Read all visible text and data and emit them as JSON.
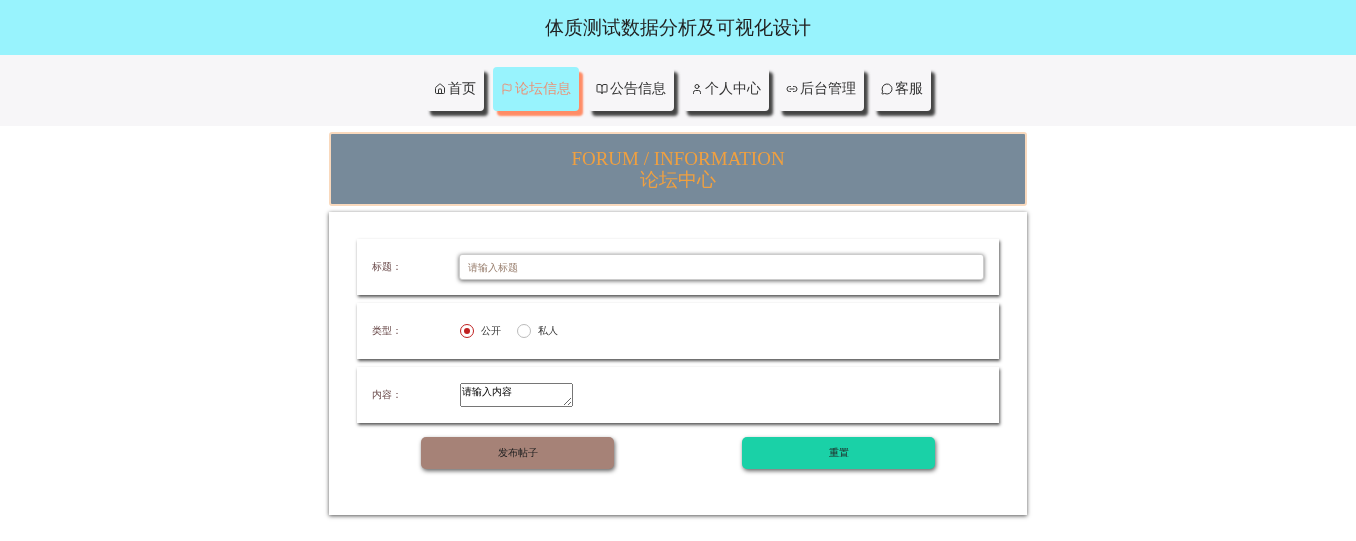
{
  "header": {
    "title": "体质测试数据分析及可视化设计"
  },
  "nav": [
    {
      "label": "首页",
      "selected": false
    },
    {
      "label": "论坛信息",
      "selected": true
    },
    {
      "label": "公告信息",
      "selected": false
    },
    {
      "label": "个人中心",
      "selected": false
    },
    {
      "label": "后台管理",
      "selected": false
    },
    {
      "label": "客服",
      "selected": false
    }
  ],
  "banner": {
    "title_en": "FORUM / INFORMATION",
    "title_zh": "论坛中心"
  },
  "form": {
    "fields": [
      {
        "kind": "text",
        "label": "标题：",
        "placeholder": "请输入标题"
      },
      {
        "kind": "radio",
        "label": "类型：",
        "options": [
          {
            "label": "公开",
            "selected": true
          },
          {
            "label": "私人",
            "selected": false
          }
        ]
      },
      {
        "kind": "textarea",
        "label": "内容：",
        "value": "请输入内容"
      }
    ],
    "buttons": [
      {
        "label": "发布帖子",
        "kind": "submit"
      },
      {
        "label": "重置",
        "kind": "reset"
      }
    ]
  }
}
